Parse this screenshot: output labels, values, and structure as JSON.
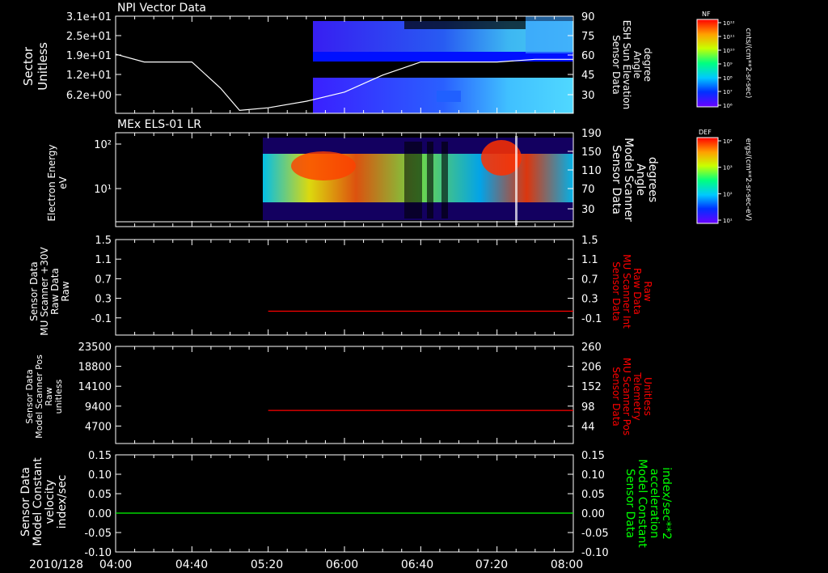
{
  "date_label": "2010/128",
  "time_ticks": [
    "04:00",
    "04:40",
    "05:20",
    "06:00",
    "06:40",
    "07:20",
    "08:00"
  ],
  "colors": {
    "background": "#000000",
    "axis": "#ffffff",
    "red_trace": "#ff0000",
    "green_trace": "#00ff00"
  },
  "colorbars": [
    {
      "label": "NF",
      "unit": "cnts/(cm**2-sr-sec)",
      "ticks": [
        "10¹²",
        "10¹¹",
        "10¹⁰",
        "10⁹",
        "10⁸",
        "10⁷",
        "10⁶"
      ],
      "scale": "log"
    },
    {
      "label": "DEF",
      "unit": "ergs/(cm**2-sr-sec-eV)",
      "ticks": [
        "10⁴",
        "10³",
        "10²",
        "10¹"
      ],
      "scale": "log"
    }
  ],
  "chart_data": [
    {
      "type": "heatmap",
      "title": "NPI Vector Data",
      "ylabel": "Sector\nUnitless",
      "y_ticks": [
        "3.1e+01",
        "2.5e+01",
        "1.9e+01",
        "1.2e+01",
        "6.2e+00"
      ],
      "y2label": "Sensor Data\nESH Sun Elevation\nAngle\ndegree",
      "y2_ticks": [
        "90",
        "75",
        "60",
        "45",
        "30"
      ],
      "y2lim": [
        15,
        90
      ],
      "heatmap_start": "05:45",
      "overlay_series": {
        "name": "ESH Sun Elevation Angle",
        "x": [
          "04:00",
          "04:15",
          "04:40",
          "04:55",
          "05:05",
          "05:20",
          "05:40",
          "06:00",
          "06:20",
          "06:40",
          "07:00",
          "07:20",
          "07:40",
          "08:00"
        ],
        "y": [
          61,
          55,
          55,
          35,
          18,
          20,
          25,
          32,
          45,
          55,
          55,
          55,
          57,
          57
        ]
      }
    },
    {
      "type": "heatmap",
      "title": "MEx ELS-01 LR",
      "ylabel": "Electron Energy\neV",
      "y_ticks": [
        "10²",
        "10¹"
      ],
      "y2label": "Sensor Data\nModel Scanner\nAngle\ndegrees",
      "y2_ticks": [
        "190",
        "150",
        "110",
        "70",
        "30"
      ],
      "heatmap_start": "05:20"
    },
    {
      "type": "line",
      "ylabel": "Sensor Data\nMU Scanner +30V\nRaw Data\nRaw",
      "y_ticks": [
        "1.5",
        "1.1",
        "0.7",
        "0.3",
        "-0.1"
      ],
      "ylim": [
        -0.5,
        1.5
      ],
      "y2label": "Sensor Data\nMU Scanner Int\nRaw Data\nRaw",
      "y2_ticks": [
        "1.5",
        "1.1",
        "0.7",
        "0.3",
        "-0.1"
      ],
      "series": [
        {
          "x": [
            "05:20",
            "08:00"
          ],
          "y": [
            0.0,
            0.0
          ],
          "color": "#ff0000"
        }
      ]
    },
    {
      "type": "line",
      "ylabel": "Sensor Data\nModel Scanner Pos\nRaw\nunitless",
      "y_ticks": [
        "23500",
        "18800",
        "14100",
        "9400",
        "4700"
      ],
      "ylim": [
        0,
        23500
      ],
      "y2label": "Sensor Data\nMU Scanner Pos\nTelemetry\nUnitless",
      "y2_ticks": [
        "260",
        "206",
        "152",
        "98",
        "44"
      ],
      "series": [
        {
          "x": [
            "05:20",
            "08:00"
          ],
          "y": [
            8000,
            8000
          ],
          "color": "#ff0000"
        }
      ]
    },
    {
      "type": "line",
      "ylabel": "Sensor Data\nModel Constant\nvelocity\nindex/sec",
      "y_ticks": [
        "0.15",
        "0.10",
        "0.05",
        "0.00",
        "-0.05",
        "-0.10"
      ],
      "ylim": [
        -0.1,
        0.15
      ],
      "y2label": "Sensor Data\nModel Constant\nacceleration\nindex/sec**2",
      "y2_ticks": [
        "0.15",
        "0.10",
        "0.05",
        "0.00",
        "-0.05",
        "-0.10"
      ],
      "series": [
        {
          "x": [
            "04:00",
            "08:00"
          ],
          "y": [
            0.0,
            0.0
          ],
          "color": "#00ff00"
        }
      ]
    }
  ]
}
